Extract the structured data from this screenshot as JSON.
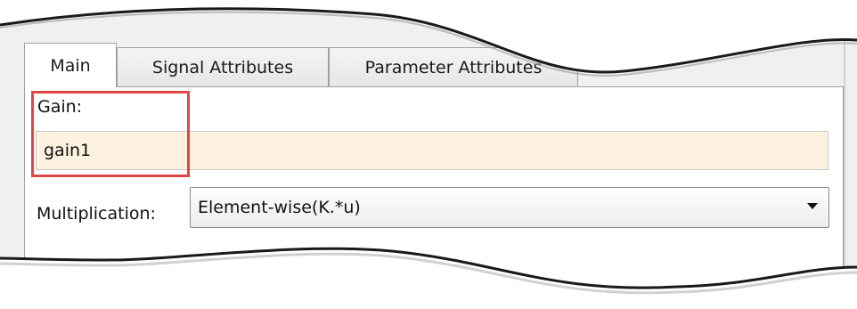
{
  "tabs": [
    {
      "label": "Main",
      "active": true
    },
    {
      "label": "Signal Attributes",
      "active": false
    },
    {
      "label": "Parameter Attributes",
      "active": false
    }
  ],
  "gain": {
    "label": "Gain:",
    "value": "gain1"
  },
  "multiplication": {
    "label": "Multiplication:",
    "selected": "Element-wise(K.*u)"
  },
  "colors": {
    "highlight": "#e04646",
    "field_background": "#fdf1e0"
  }
}
